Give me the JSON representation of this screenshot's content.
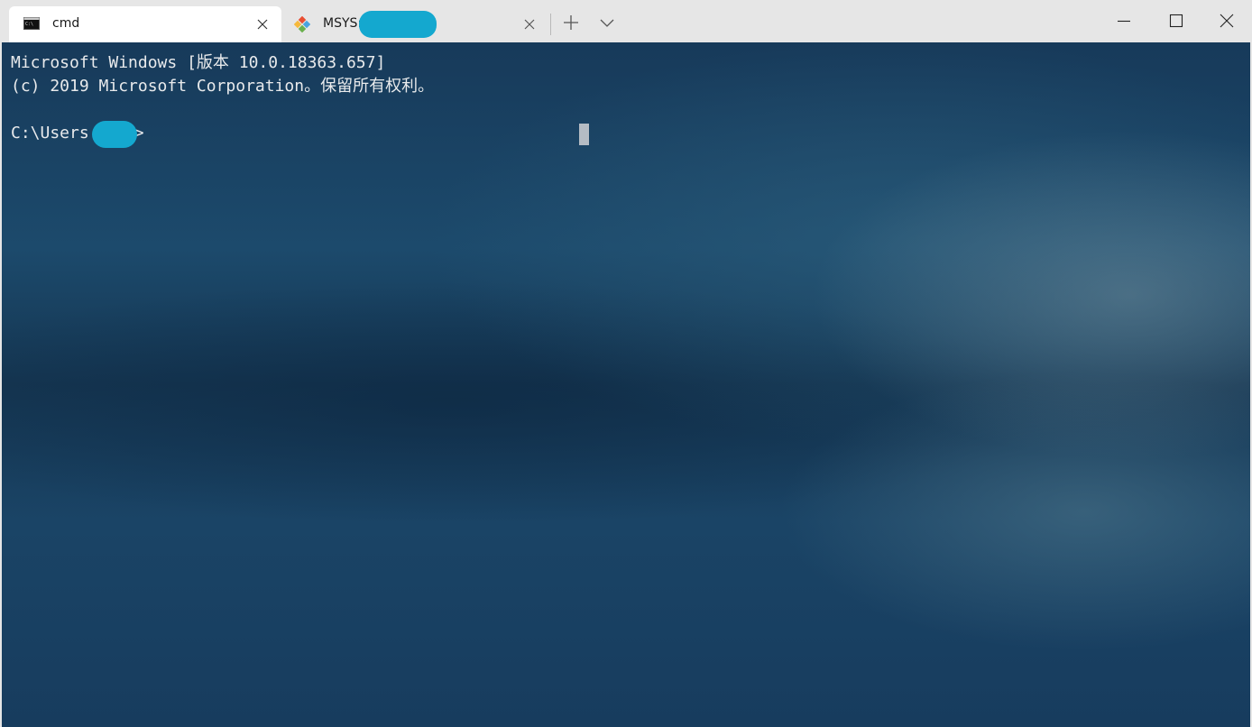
{
  "tabs": [
    {
      "title": "cmd",
      "icon": "cmd-icon",
      "active": true
    },
    {
      "title": "MSYS:",
      "icon": "git-icon",
      "active": false
    }
  ],
  "titlebar": {
    "new_tab_icon": "plus-icon",
    "dropdown_icon": "chevron-down-icon"
  },
  "window_controls": [
    "minimize-icon",
    "maximize-icon",
    "close-icon"
  ],
  "terminal": {
    "lines": [
      "Microsoft Windows [版本 10.0.18363.657]",
      "(c) 2019 Microsoft Corporation。保留所有权利。",
      "C:\\Users"
    ],
    "prompt_suffix": ">"
  },
  "colors": {
    "titlebar_bg": "#e6e6e6",
    "active_tab_bg": "#ffffff",
    "terminal_fg": "#e8eaec",
    "redaction": "#14a8cf"
  }
}
